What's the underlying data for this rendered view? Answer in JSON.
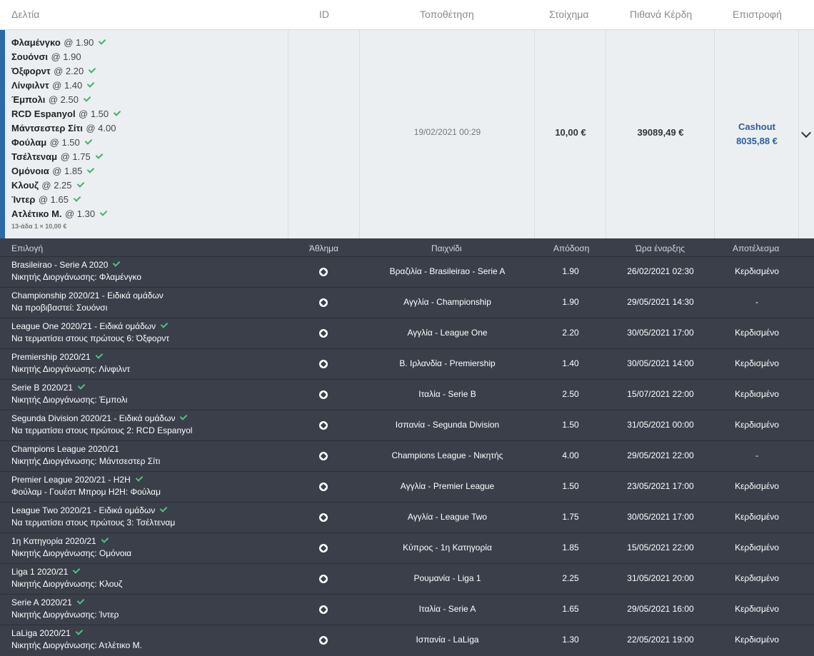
{
  "header": {
    "tickets": "Δελτία",
    "id": "ID",
    "placement": "Τοποθέτηση",
    "stake": "Στοίχημα",
    "potential": "Πιθανά Κέρδη",
    "return": "Επιστροφή"
  },
  "ticket": {
    "selections": [
      {
        "team": "Φλαμένγκο",
        "odd": "@ 1.90",
        "won": true
      },
      {
        "team": "Σουόνσι",
        "odd": "@ 1.90",
        "won": false
      },
      {
        "team": "Όξφορντ",
        "odd": "@ 2.20",
        "won": true
      },
      {
        "team": "Λίνφιλντ",
        "odd": "@ 1.40",
        "won": true
      },
      {
        "team": "Έμπολι",
        "odd": "@ 2.50",
        "won": true
      },
      {
        "team": "RCD Espanyol",
        "odd": "@ 1.50",
        "won": true
      },
      {
        "team": "Μάντσεστερ Σίτι",
        "odd": "@ 4.00",
        "won": false
      },
      {
        "team": "Φούλαμ",
        "odd": "@ 1.50",
        "won": true
      },
      {
        "team": "Τσέλτεναμ",
        "odd": "@ 1.75",
        "won": true
      },
      {
        "team": "Ομόνοια",
        "odd": "@ 1.85",
        "won": true
      },
      {
        "team": "Κλουζ",
        "odd": "@ 2.25",
        "won": true
      },
      {
        "team": "Ίντερ",
        "odd": "@ 1.65",
        "won": true
      },
      {
        "team": "Ατλέτικο Μ.",
        "odd": "@ 1.30",
        "won": true
      }
    ],
    "combo": "13-άδα 1 × 10,00 €",
    "placed": "19/02/2021 00:29",
    "stake": "10,00 €",
    "potential": "39089,49 €",
    "cashout_label": "Cashout",
    "cashout_value": "8035,88 €"
  },
  "details": {
    "headers": {
      "selection": "Επιλογή",
      "sport": "Άθλημα",
      "game": "Παιχνίδι",
      "odds": "Απόδοση",
      "start": "Ώρα έναρξης",
      "result": "Αποτέλεσμα"
    },
    "rows": [
      {
        "league": "Brasileirao - Serie A 2020",
        "market": "Νικητής Διοργάνωσης: Φλαμένγκο",
        "won": true,
        "game": "Βραζιλία - Brasileirao - Serie A",
        "odds": "1.90",
        "start": "26/02/2021 02:30",
        "result": "Κερδισμένο"
      },
      {
        "league": "Championship 2020/21 - Ειδικά ομάδων",
        "market": "Να προβιβαστεί: Σουόνσι",
        "won": false,
        "game": "Αγγλία - Championship",
        "odds": "1.90",
        "start": "29/05/2021 14:30",
        "result": "-"
      },
      {
        "league": "League One 2020/21 - Ειδικά ομάδων",
        "market": "Να τερματίσει στους πρώτους 6: Όξφορντ",
        "won": true,
        "game": "Αγγλία - League One",
        "odds": "2.20",
        "start": "30/05/2021 17:00",
        "result": "Κερδισμένο"
      },
      {
        "league": "Premiership 2020/21",
        "market": "Νικητής Διοργάνωσης: Λίνφιλντ",
        "won": true,
        "game": "Β. Ιρλανδία - Premiership",
        "odds": "1.40",
        "start": "30/05/2021 14:00",
        "result": "Κερδισμένο"
      },
      {
        "league": "Serie B 2020/21",
        "market": "Νικητής Διοργάνωσης: Έμπολι",
        "won": true,
        "game": "Ιταλία - Serie B",
        "odds": "2.50",
        "start": "15/07/2021 22:00",
        "result": "Κερδισμένο"
      },
      {
        "league": "Segunda Division 2020/21 - Ειδικά ομάδων",
        "market": "Να τερματίσει στους πρώτους 2: RCD Espanyol",
        "won": true,
        "game": "Ισπανία - Segunda Division",
        "odds": "1.50",
        "start": "31/05/2021 00:00",
        "result": "Κερδισμένο"
      },
      {
        "league": "Champions League 2020/21",
        "market": "Νικητής Διοργάνωσης: Μάντσεστερ Σίτι",
        "won": false,
        "game": "Champions League - Νικητής",
        "odds": "4.00",
        "start": "29/05/2021 22:00",
        "result": "-"
      },
      {
        "league": "Premier League 2020/21 - H2H",
        "market": "Φούλαμ - Γουέστ Μπρομ H2H: Φούλαμ",
        "won": true,
        "game": "Αγγλία - Premier League",
        "odds": "1.50",
        "start": "23/05/2021 17:00",
        "result": "Κερδισμένο"
      },
      {
        "league": "League Two 2020/21 - Ειδικά ομάδων",
        "market": "Να τερματίσει στους πρώτους 3: Τσέλτεναμ",
        "won": true,
        "game": "Αγγλία - League Two",
        "odds": "1.75",
        "start": "30/05/2021 17:00",
        "result": "Κερδισμένο"
      },
      {
        "league": "1η Κατηγορία 2020/21",
        "market": "Νικητής Διοργάνωσης: Ομόνοια",
        "won": true,
        "game": "Κύπρος - 1η Κατηγορία",
        "odds": "1.85",
        "start": "15/05/2021 22:00",
        "result": "Κερδισμένο"
      },
      {
        "league": "Liga 1 2020/21",
        "market": "Νικητής Διοργάνωσης: Κλουζ",
        "won": true,
        "game": "Ρουμανία - Liga 1",
        "odds": "2.25",
        "start": "31/05/2021 20:00",
        "result": "Κερδισμένο"
      },
      {
        "league": "Serie A 2020/21",
        "market": "Νικητής Διοργάνωσης: Ίντερ",
        "won": true,
        "game": "Ιταλία - Serie A",
        "odds": "1.65",
        "start": "29/05/2021 16:00",
        "result": "Κερδισμένο"
      },
      {
        "league": "LaLiga 2020/21",
        "market": "Νικητής Διοργάνωσης: Ατλέτικο Μ.",
        "won": true,
        "game": "Ισπανία - LaLiga",
        "odds": "1.30",
        "start": "22/05/2021 19:00",
        "result": "Κερδισμένο"
      }
    ]
  }
}
